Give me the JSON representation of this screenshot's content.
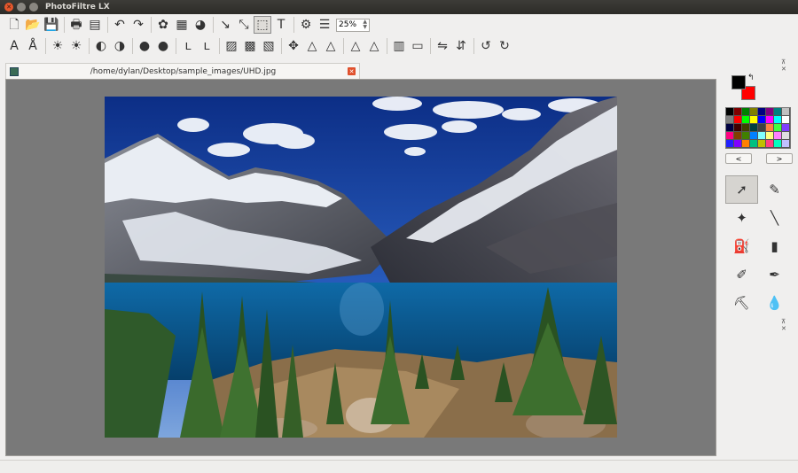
{
  "window": {
    "title": "PhotoFiltre LX",
    "controls": [
      "close",
      "minimize",
      "maximize"
    ]
  },
  "toolbar1": {
    "groups": [
      [
        {
          "name": "new-file-icon",
          "glyph": "🗋"
        },
        {
          "name": "open-folder-icon",
          "glyph": "📂"
        },
        {
          "name": "save-icon",
          "glyph": "💾"
        }
      ],
      [
        {
          "name": "print-icon",
          "glyph": "🖶"
        },
        {
          "name": "scan-icon",
          "glyph": "▤"
        }
      ],
      [
        {
          "name": "undo-icon",
          "glyph": "↶"
        },
        {
          "name": "redo-icon",
          "glyph": "↷"
        }
      ],
      [
        {
          "name": "rgb-channels-icon",
          "glyph": "✿"
        },
        {
          "name": "mosaic-icon",
          "glyph": "▦"
        },
        {
          "name": "color-balance-icon",
          "glyph": "◕"
        }
      ],
      [
        {
          "name": "selection-arrow-icon",
          "glyph": "↘"
        },
        {
          "name": "crop-icon",
          "glyph": "⤡"
        },
        {
          "name": "select-rect-icon",
          "glyph": "⬚",
          "pressed": true
        },
        {
          "name": "text-tool-icon",
          "glyph": "T"
        }
      ],
      [
        {
          "name": "settings-gear-icon",
          "glyph": "⚙"
        },
        {
          "name": "image-size-icon",
          "glyph": "☰"
        }
      ]
    ],
    "zoom_value": "25%"
  },
  "toolbar2": {
    "groups": [
      [
        {
          "name": "text-style-icon",
          "glyph": "A"
        },
        {
          "name": "text-effect-icon",
          "glyph": "Å"
        }
      ],
      [
        {
          "name": "brightness-minus-icon",
          "glyph": "☀"
        },
        {
          "name": "brightness-plus-icon",
          "glyph": "☀"
        }
      ],
      [
        {
          "name": "contrast-minus-icon",
          "glyph": "◐"
        },
        {
          "name": "contrast-plus-icon",
          "glyph": "◑"
        }
      ],
      [
        {
          "name": "saturation-minus-icon",
          "glyph": "●"
        },
        {
          "name": "saturation-plus-icon",
          "glyph": "●"
        }
      ],
      [
        {
          "name": "gamma-minus-icon",
          "glyph": "ʟ"
        },
        {
          "name": "gamma-plus-icon",
          "glyph": "ʟ"
        }
      ],
      [
        {
          "name": "auto-level-icon",
          "glyph": "▨"
        },
        {
          "name": "auto-contrast-icon",
          "glyph": "▩"
        },
        {
          "name": "sepia-icon",
          "glyph": "▧"
        }
      ],
      [
        {
          "name": "move-icon",
          "glyph": "✥"
        },
        {
          "name": "blur-icon",
          "glyph": "△"
        },
        {
          "name": "sharpen-icon",
          "glyph": "△"
        }
      ],
      [
        {
          "name": "soften-icon",
          "glyph": "△"
        },
        {
          "name": "sharpen-more-icon",
          "glyph": "△"
        }
      ],
      [
        {
          "name": "rainbow-gradient-icon",
          "glyph": "▥"
        },
        {
          "name": "gray-gradient-icon",
          "glyph": "▭"
        }
      ],
      [
        {
          "name": "flip-horizontal-icon",
          "glyph": "⇋"
        },
        {
          "name": "flip-vertical-icon",
          "glyph": "⇵"
        }
      ],
      [
        {
          "name": "rotate-left-icon",
          "glyph": "↺"
        },
        {
          "name": "rotate-right-icon",
          "glyph": "↻"
        }
      ]
    ]
  },
  "document": {
    "path": "/home/dylan/Desktop/sample_images/UHD.jpg"
  },
  "colors": {
    "foreground": "#000000",
    "background": "#ff0000",
    "palette": [
      "#000000",
      "#800000",
      "#008000",
      "#808000",
      "#000080",
      "#800080",
      "#008080",
      "#c0c0c0",
      "#808080",
      "#ff0000",
      "#00ff00",
      "#ffff00",
      "#0000ff",
      "#ff00ff",
      "#00ffff",
      "#ffffff",
      "#000040",
      "#400000",
      "#404000",
      "#004040",
      "#404040",
      "#ff8040",
      "#40ff40",
      "#8040ff",
      "#ff0080",
      "#804000",
      "#408000",
      "#0080ff",
      "#80ffff",
      "#ffff80",
      "#ff80ff",
      "#e0e0e0",
      "#2020ff",
      "#8000ff",
      "#ff8000",
      "#00c080",
      "#c0c000",
      "#ff4080",
      "#00ffc0",
      "#c0c0ff"
    ],
    "prev_label": "<",
    "next_label": ">"
  },
  "tools": [
    {
      "name": "select-arrow-icon",
      "glyph": "➚",
      "active": true
    },
    {
      "name": "eyedropper-icon",
      "glyph": "✎"
    },
    {
      "name": "magic-wand-icon",
      "glyph": "✦"
    },
    {
      "name": "line-tool-icon",
      "glyph": "╲"
    },
    {
      "name": "fill-bucket-icon",
      "glyph": "⛽"
    },
    {
      "name": "spray-can-icon",
      "glyph": "▮"
    },
    {
      "name": "brush-icon",
      "glyph": "✐"
    },
    {
      "name": "advanced-brush-icon",
      "glyph": "✒"
    },
    {
      "name": "clone-stamp-icon",
      "glyph": "⛏"
    },
    {
      "name": "blur-drop-icon",
      "glyph": "💧"
    }
  ]
}
